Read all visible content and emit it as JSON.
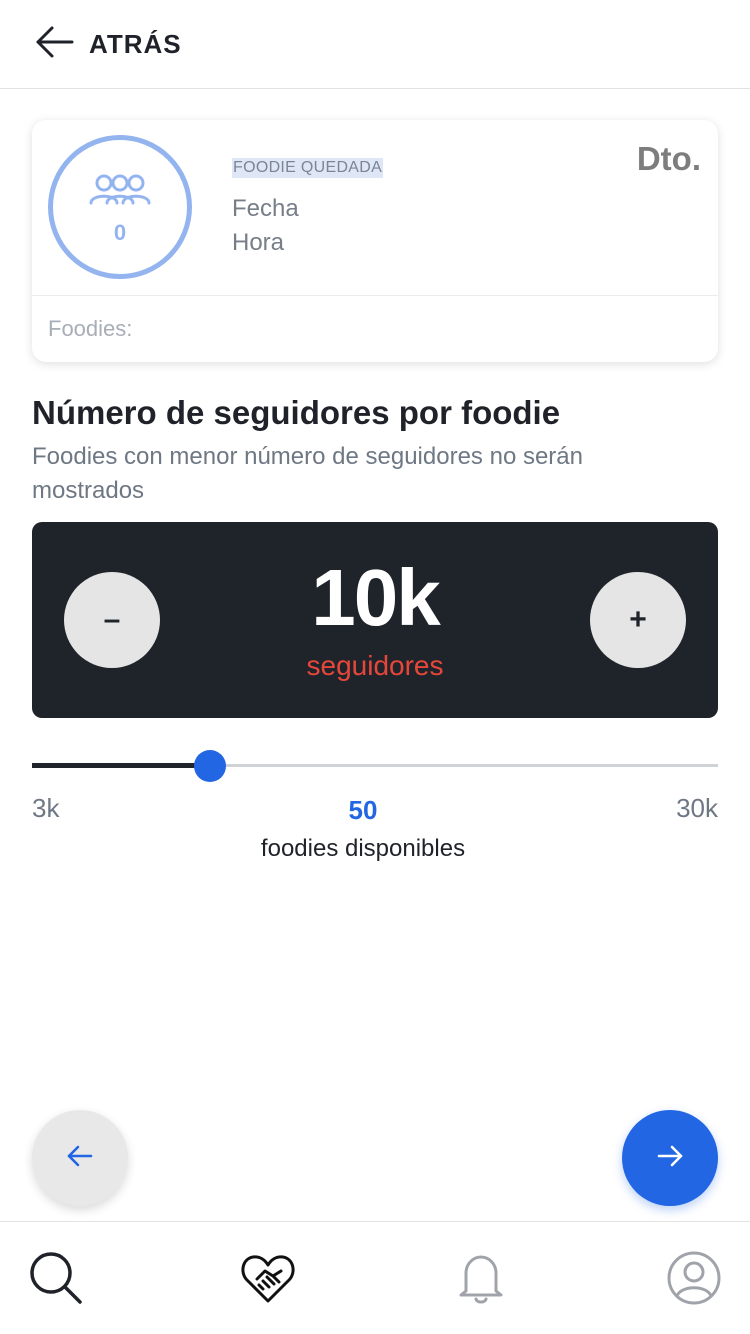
{
  "header": {
    "back_label": "ATRÁS",
    "back_icon": "arrow-left-icon"
  },
  "card": {
    "people_count": "0",
    "people_icon": "group-icon",
    "tag": "FOODIE QUEDADA",
    "date_label": "Fecha",
    "time_label": "Hora",
    "discount_label": "Dto.",
    "foodies_label": "Foodies:",
    "accent_color": "#93b4ef"
  },
  "section": {
    "title": "Número de seguidores por foodie",
    "subtitle": "Foodies con menor número de seguidores no serán mostrados"
  },
  "counter": {
    "minus_label": "–",
    "plus_label": "+",
    "value": "10k",
    "unit": "seguidores",
    "unit_color": "#e7473a"
  },
  "slider": {
    "min_label": "3k",
    "max_label": "30k",
    "min_value": 3000,
    "max_value": 30000,
    "value": 10000,
    "available_count": "50",
    "available_label": "foodies disponibles",
    "accent_color": "#2266e3"
  },
  "nav": {
    "prev_icon": "arrow-left-icon",
    "next_icon": "arrow-right-icon"
  },
  "tabbar": {
    "tabs": [
      {
        "icon": "search-icon"
      },
      {
        "icon": "handshake-heart-icon"
      },
      {
        "icon": "bell-icon"
      },
      {
        "icon": "profile-icon"
      }
    ]
  }
}
